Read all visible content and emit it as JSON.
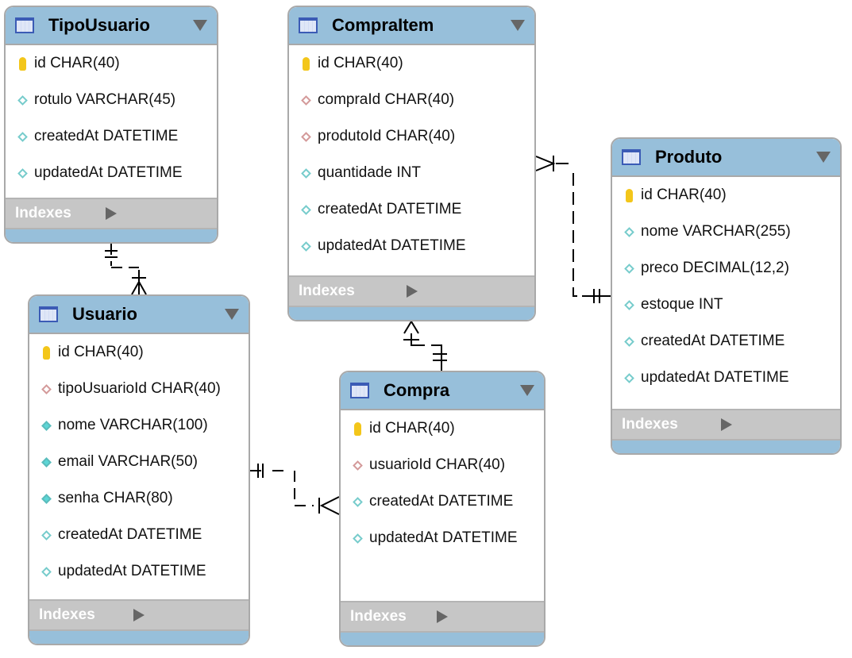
{
  "indexes_label": "Indexes",
  "colors": {
    "header": "#97bfda",
    "indexes": "#c6c6c6",
    "pk": "#f3c61a",
    "fk": "#d49a9a",
    "column": "#77cccc"
  },
  "tables": [
    {
      "name": "TipoUsuario",
      "columns": [
        {
          "text": "id CHAR(40)",
          "kind": "pk"
        },
        {
          "text": "rotulo VARCHAR(45)",
          "kind": "col"
        },
        {
          "text": "createdAt DATETIME",
          "kind": "col"
        },
        {
          "text": "updatedAt DATETIME",
          "kind": "col"
        }
      ]
    },
    {
      "name": "CompraItem",
      "columns": [
        {
          "text": "id CHAR(40)",
          "kind": "pk"
        },
        {
          "text": "compraId CHAR(40)",
          "kind": "fk"
        },
        {
          "text": "produtoId CHAR(40)",
          "kind": "fk"
        },
        {
          "text": "quantidade INT",
          "kind": "col"
        },
        {
          "text": "createdAt DATETIME",
          "kind": "col"
        },
        {
          "text": "updatedAt DATETIME",
          "kind": "col"
        }
      ]
    },
    {
      "name": "Produto",
      "columns": [
        {
          "text": "id CHAR(40)",
          "kind": "pk"
        },
        {
          "text": "nome VARCHAR(255)",
          "kind": "col"
        },
        {
          "text": "preco DECIMAL(12,2)",
          "kind": "col"
        },
        {
          "text": "estoque INT",
          "kind": "col"
        },
        {
          "text": "createdAt DATETIME",
          "kind": "col"
        },
        {
          "text": "updatedAt DATETIME",
          "kind": "col"
        }
      ]
    },
    {
      "name": "Usuario",
      "columns": [
        {
          "text": "id CHAR(40)",
          "kind": "pk"
        },
        {
          "text": "tipoUsuarioId CHAR(40)",
          "kind": "fk"
        },
        {
          "text": "nome VARCHAR(100)",
          "kind": "nn"
        },
        {
          "text": "email VARCHAR(50)",
          "kind": "nn"
        },
        {
          "text": "senha CHAR(80)",
          "kind": "nn"
        },
        {
          "text": "createdAt DATETIME",
          "kind": "col"
        },
        {
          "text": "updatedAt DATETIME",
          "kind": "col"
        }
      ]
    },
    {
      "name": "Compra",
      "columns": [
        {
          "text": "id CHAR(40)",
          "kind": "pk"
        },
        {
          "text": "usuarioId CHAR(40)",
          "kind": "fk"
        },
        {
          "text": "createdAt DATETIME",
          "kind": "col"
        },
        {
          "text": "updatedAt DATETIME",
          "kind": "col"
        }
      ]
    }
  ],
  "relationships": [
    {
      "from": "TipoUsuario",
      "to": "Usuario",
      "type": "one-to-many"
    },
    {
      "from": "Compra",
      "to": "CompraItem",
      "type": "one-to-many"
    },
    {
      "from": "Produto",
      "to": "CompraItem",
      "type": "one-to-many"
    },
    {
      "from": "Usuario",
      "to": "Compra",
      "type": "one-to-many"
    }
  ]
}
